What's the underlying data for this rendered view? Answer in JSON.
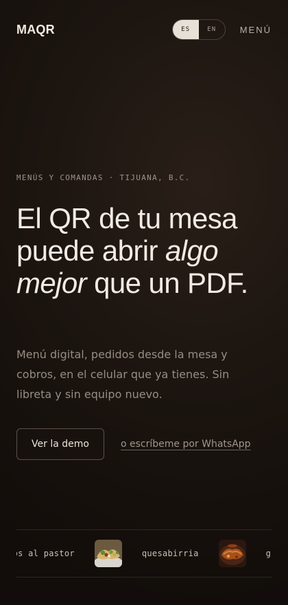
{
  "header": {
    "logo": "MAQR",
    "lang_es": "ES",
    "lang_en": "EN",
    "lang_active": "ES",
    "menu_label": "MENÚ"
  },
  "hero": {
    "eyebrow": "MENÚS Y COMANDAS · TIJUANA, B.C.",
    "headline_part1": "El QR de tu mesa puede abrir",
    "headline_italic": "algo mejor",
    "headline_part2": "que un PDF.",
    "subtext": "Menú digital, pedidos desde la mesa y cobros, en el celular que ya tienes. Sin libreta y sin equipo nuevo.",
    "demo_button": "Ver la demo",
    "whatsapp_link": "o escríbeme por WhatsApp"
  },
  "marquee": {
    "items": [
      "tacos al pastor",
      "quesabirria",
      "guacamole"
    ],
    "thumb_icons": [
      "tacos-photo-icon",
      "quesabirria-photo-icon"
    ]
  },
  "colors": {
    "background": "#1a130f",
    "text_primary": "#f1ebe3",
    "text_muted": "#958d84",
    "toggle_active_bg": "#e7e0d6"
  }
}
